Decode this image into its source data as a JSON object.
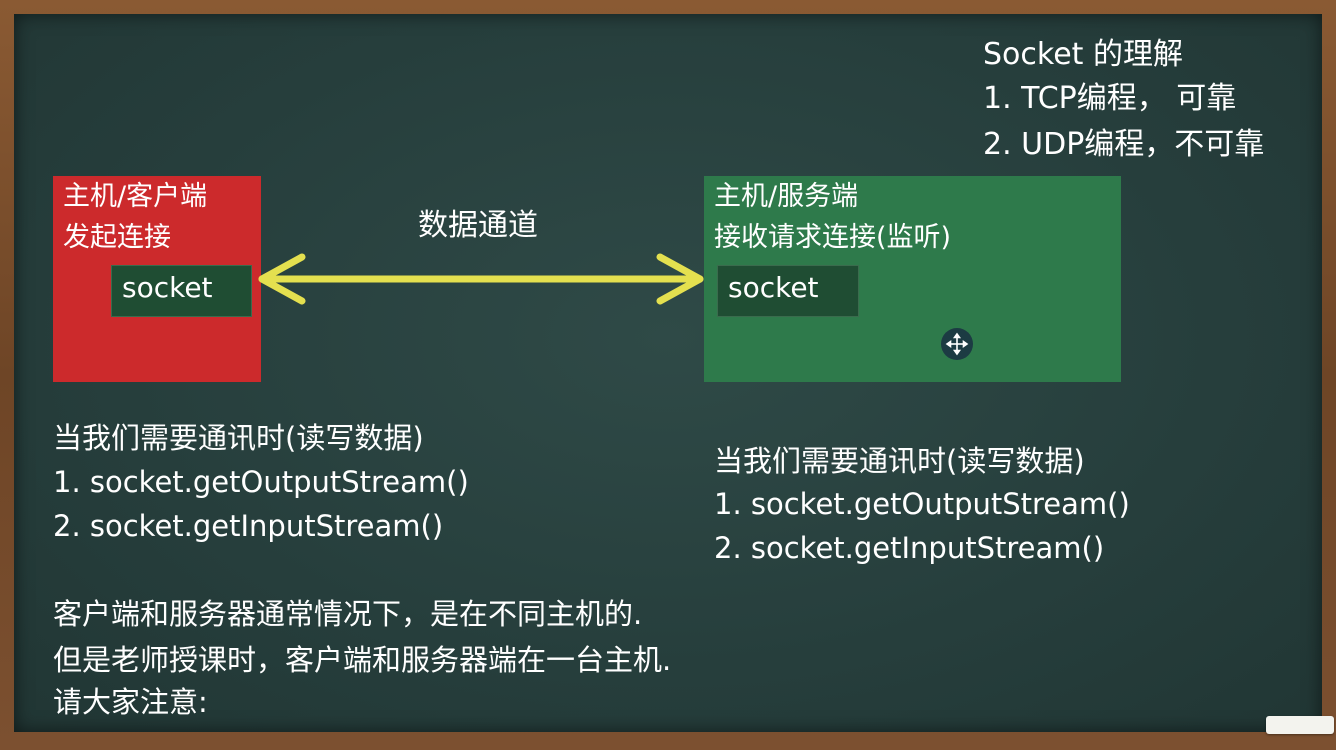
{
  "title_block": {
    "title": "Socket 的理解",
    "item1": "1. TCP编程， 可靠",
    "item2": "2. UDP编程，不可靠"
  },
  "client": {
    "line1": "主机/客户端",
    "line2": "发起连接",
    "socket_label": "socket"
  },
  "server": {
    "line1": "主机/服务端",
    "line2": "接收请求连接(监听)",
    "socket_label": "socket"
  },
  "channel_label": "数据通道",
  "left_notes": {
    "heading": "当我们需要通讯时(读写数据)",
    "line1": "1. socket.getOutputStream()",
    "line2": "2. socket.getInputStream()"
  },
  "right_notes": {
    "heading": "当我们需要通讯时(读写数据)",
    "line1": "1. socket.getOutputStream()",
    "line2": "2. socket.getInputStream()"
  },
  "footer": {
    "line1": "客户端和服务器通常情况下，是在不同主机的.",
    "line2": "但是老师授课时，客户端和服务器端在一台主机.",
    "line3": "请大家注意:"
  },
  "colors": {
    "board": "#263e3c",
    "client_box": "#cc2a2c",
    "server_box": "#2e7a4b",
    "arrow": "#e4e04f",
    "socket_box": "#1f4d33"
  },
  "icons": {
    "arrow": "double-headed-arrow",
    "cursor": "move-cursor-icon"
  }
}
